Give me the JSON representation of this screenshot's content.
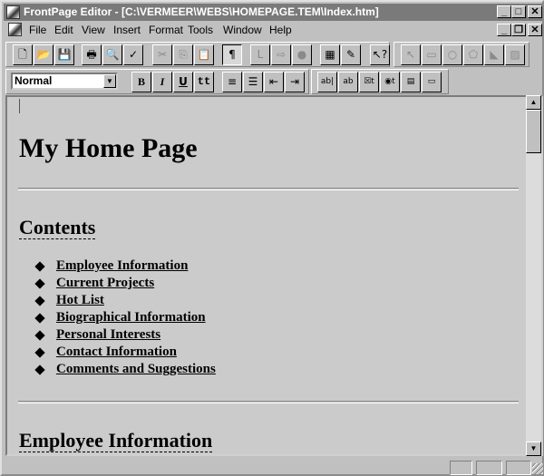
{
  "window": {
    "title": "FrontPage Editor - [C:\\VERMEER\\WEBS\\HOMEPAGE.TEM\\Index.htm]"
  },
  "menu": [
    "File",
    "Edit",
    "View",
    "Insert",
    "Format",
    "Tools",
    "Window",
    "Help"
  ],
  "toolbar_standard": [
    {
      "name": "new",
      "glyph": "🗋",
      "enabled": true
    },
    {
      "name": "open",
      "glyph": "📂",
      "enabled": true
    },
    {
      "name": "save",
      "glyph": "💾",
      "enabled": true
    },
    {
      "name": "print",
      "glyph": "🖶",
      "enabled": true
    },
    {
      "name": "print-preview",
      "glyph": "🔍",
      "enabled": true
    },
    {
      "name": "spelling",
      "glyph": "✓",
      "enabled": true
    },
    {
      "name": "cut",
      "glyph": "✂",
      "enabled": false
    },
    {
      "name": "copy",
      "glyph": "⎘",
      "enabled": false
    },
    {
      "name": "paste",
      "glyph": "📋",
      "enabled": true
    },
    {
      "name": "show-paragraph-marks",
      "glyph": "¶",
      "enabled": true,
      "pressed": true
    },
    {
      "name": "link",
      "glyph": "L",
      "enabled": false
    },
    {
      "name": "forward",
      "glyph": "⇨",
      "enabled": false
    },
    {
      "name": "stop",
      "glyph": "●",
      "enabled": false
    },
    {
      "name": "explorer",
      "glyph": "▦",
      "enabled": true
    },
    {
      "name": "to-do",
      "glyph": "✎",
      "enabled": true
    },
    {
      "name": "help",
      "glyph": "↖?",
      "enabled": true
    },
    {
      "name": "pointer",
      "glyph": "↖",
      "enabled": false
    },
    {
      "name": "rectangle",
      "glyph": "▭",
      "enabled": false
    },
    {
      "name": "circle",
      "glyph": "○",
      "enabled": false
    },
    {
      "name": "polygon",
      "glyph": "⬠",
      "enabled": false
    },
    {
      "name": "hotspot",
      "glyph": "◣",
      "enabled": false
    },
    {
      "name": "highlight",
      "glyph": "▨",
      "enabled": false
    }
  ],
  "toolbar_format": {
    "style_value": "Normal",
    "buttons": [
      {
        "name": "bold",
        "glyph": "B"
      },
      {
        "name": "italic",
        "glyph": "I"
      },
      {
        "name": "underline",
        "glyph": "U"
      },
      {
        "name": "typewriter",
        "glyph": "tt"
      },
      {
        "name": "numbered-list",
        "glyph": "≡"
      },
      {
        "name": "bulleted-list",
        "glyph": "☰"
      },
      {
        "name": "decrease-indent",
        "glyph": "⇤"
      },
      {
        "name": "increase-indent",
        "glyph": "⇥"
      }
    ],
    "form_buttons": [
      {
        "name": "text-box",
        "glyph": "ab|"
      },
      {
        "name": "scrolling-text-box",
        "glyph": "ab"
      },
      {
        "name": "checkbox",
        "glyph": "☒t"
      },
      {
        "name": "radio-button",
        "glyph": "◉t"
      },
      {
        "name": "drop-down-menu",
        "glyph": "▤"
      },
      {
        "name": "push-button",
        "glyph": "▭"
      }
    ]
  },
  "document": {
    "heading": "My Home Page",
    "contents_heading": "Contents",
    "contents": [
      "Employee Information",
      "Current Projects",
      "Hot List",
      "Biographical Information",
      "Personal Interests",
      "Contact Information",
      "Comments and Suggestions"
    ],
    "section_heading": "Employee Information"
  }
}
